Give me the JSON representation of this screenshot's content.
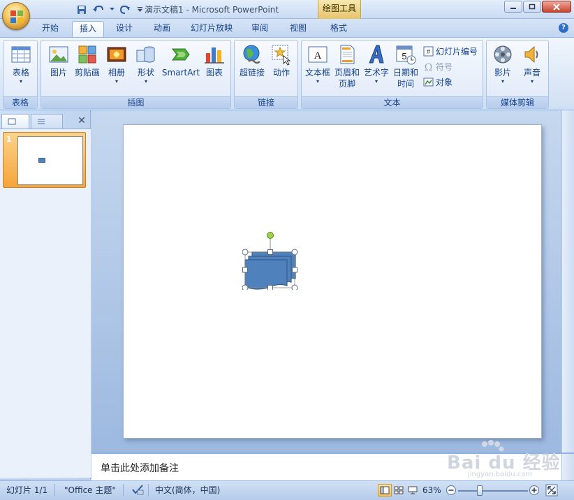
{
  "window": {
    "title": "演示文稿1 - Microsoft PowerPoint",
    "tools_tab": "绘图工具"
  },
  "tabs": [
    {
      "label": "开始"
    },
    {
      "label": "插入"
    },
    {
      "label": "设计"
    },
    {
      "label": "动画"
    },
    {
      "label": "幻灯片放映"
    },
    {
      "label": "审阅"
    },
    {
      "label": "视图"
    },
    {
      "label": "格式"
    }
  ],
  "active_tab": "插入",
  "ribbon": {
    "groups": {
      "table": {
        "label": "表格"
      },
      "illustrations": {
        "label": "插图"
      },
      "links": {
        "label": "链接"
      },
      "text": {
        "label": "文本"
      },
      "media": {
        "label": "媒体剪辑"
      }
    },
    "buttons": {
      "table": "表格",
      "picture": "图片",
      "clipart": "剪贴画",
      "album": "相册",
      "shapes": "形状",
      "smartart": "SmartArt",
      "chart": "图表",
      "hyperlink": "超链接",
      "action": "动作",
      "textbox": "文本框",
      "header_footer_1": "页眉和",
      "header_footer_2": "页脚",
      "wordart": "艺术字",
      "datetime_1": "日期和",
      "datetime_2": "时间",
      "slide_number": "幻灯片编号",
      "symbol": "符号",
      "object": "对象",
      "movie": "影片",
      "sound": "声音"
    }
  },
  "slides_pane": {
    "thumbnail_number": "1"
  },
  "notes": {
    "placeholder": "单击此处添加备注"
  },
  "status": {
    "slide": "幻灯片 1/1",
    "theme": "\"Office 主题\"",
    "language": "中文(简体，中国)",
    "zoom": "63%"
  },
  "watermark": {
    "brand": "Bai du 经验",
    "url": "jingyan.baidu.com"
  },
  "colors": {
    "shape_fill": "#4f81bd",
    "shape_stroke": "#385d8a",
    "rotate_handle": "#9bd44c",
    "ribbon_text": "#15428b"
  }
}
